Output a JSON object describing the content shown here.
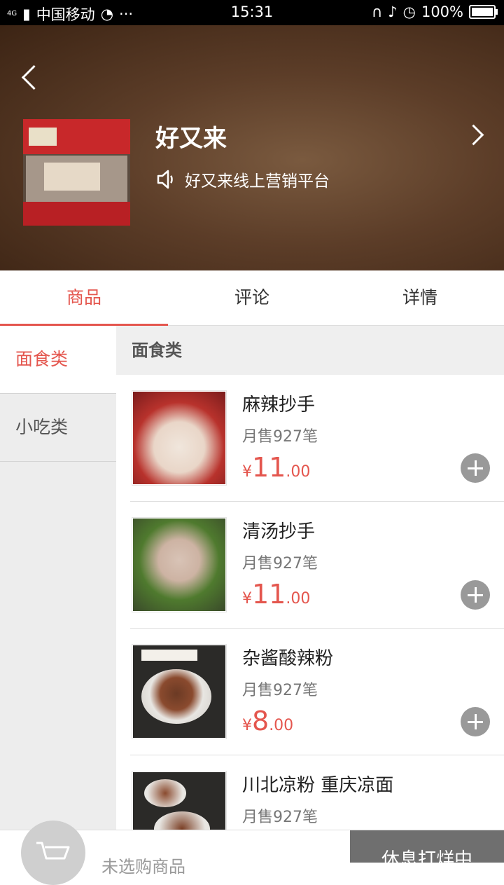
{
  "status_bar": {
    "network": "4G",
    "carrier": "中国移动",
    "dots": "···",
    "time": "15:31",
    "battery": "100%"
  },
  "shop": {
    "name": "好又来",
    "notice": "好又来线上营销平台"
  },
  "tabs": [
    {
      "label": "商品"
    },
    {
      "label": "评论"
    },
    {
      "label": "详情"
    }
  ],
  "sidebar": {
    "items": [
      {
        "label": "面食类"
      },
      {
        "label": "小吃类"
      }
    ]
  },
  "category": {
    "title": "面食类"
  },
  "items": [
    {
      "name": "麻辣抄手",
      "sales": "月售927笔",
      "currency": "¥",
      "price_int": "11",
      "price_dec": ".00"
    },
    {
      "name": "清汤抄手",
      "sales": "月售927笔",
      "currency": "¥",
      "price_int": "11",
      "price_dec": ".00"
    },
    {
      "name": "杂酱酸辣粉",
      "sales": "月售927笔",
      "currency": "¥",
      "price_int": "8",
      "price_dec": ".00"
    },
    {
      "name": "川北凉粉 重庆凉面",
      "sales": "月售927笔"
    }
  ],
  "cart": {
    "hint": "未选购商品",
    "button": "休息打烊中"
  },
  "colors": {
    "accent": "#e4564e",
    "header_bg": "#5c3d28",
    "add_button": "#999999"
  }
}
